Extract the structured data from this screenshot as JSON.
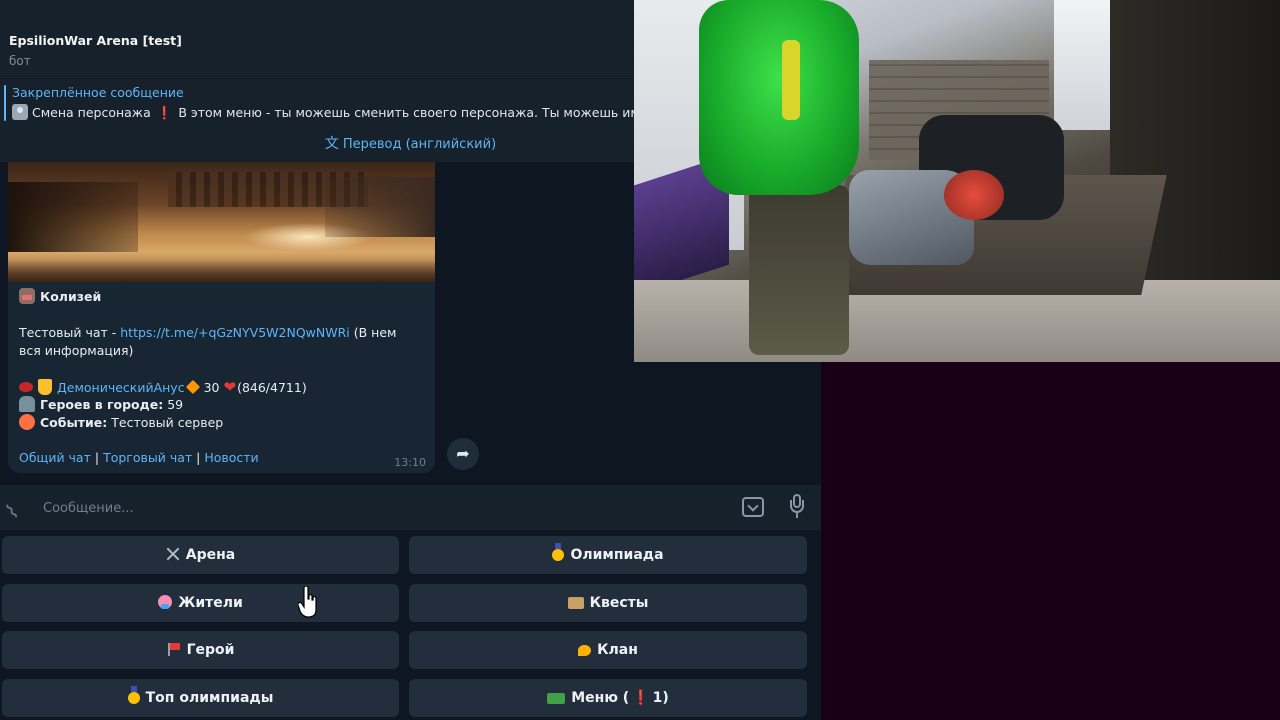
{
  "chat": {
    "title": "EpsilionWar Arena [test]",
    "subtitle": "бот"
  },
  "pinned": {
    "title": "Закреплённое сообщение",
    "prefix": "Смена персонажа",
    "text": "В этом меню - ты можешь сменить своего персонажа. Ты можешь иметь"
  },
  "translate": {
    "label": "Перевод (английский)"
  },
  "message": {
    "heading": "Колизей",
    "test_chat_label": "Тестовый чат - ",
    "test_chat_link": "https://t.me/+qGzNYV5W2NQwNWRi",
    "test_chat_note": " (В нем вся информация)",
    "player_name": "ДемоническийАнус",
    "level": "30",
    "hp": "(846/4711)",
    "heroes_label": "Героев в городе:",
    "heroes_count": "59",
    "event_label": "Событие:",
    "event_value": "Тестовый сервер",
    "footer_links": [
      "Общий чат",
      "Торговый чат",
      "Новости"
    ],
    "footer_sep": "|",
    "time": "13:10"
  },
  "composer": {
    "placeholder": "Сообщение..."
  },
  "keyboard": {
    "buttons": [
      {
        "label": "Арена",
        "icon": "crossed-swords-icon"
      },
      {
        "label": "Олимпиада",
        "icon": "medal-icon"
      },
      {
        "label": "Жители",
        "icon": "people-icon"
      },
      {
        "label": "Квесты",
        "icon": "scroll-icon"
      },
      {
        "label": "Герой",
        "icon": "flag-icon"
      },
      {
        "label": "Клан",
        "icon": "horn-icon"
      },
      {
        "label": "Топ олимпиады",
        "icon": "medal-icon"
      },
      {
        "label": "Меню (",
        "icon": "money-icon",
        "badge": "1)"
      }
    ]
  },
  "colors": {
    "accent": "#5eb5f7",
    "bg": "#0e1621",
    "panel": "#17212b",
    "button": "#222e3b"
  }
}
